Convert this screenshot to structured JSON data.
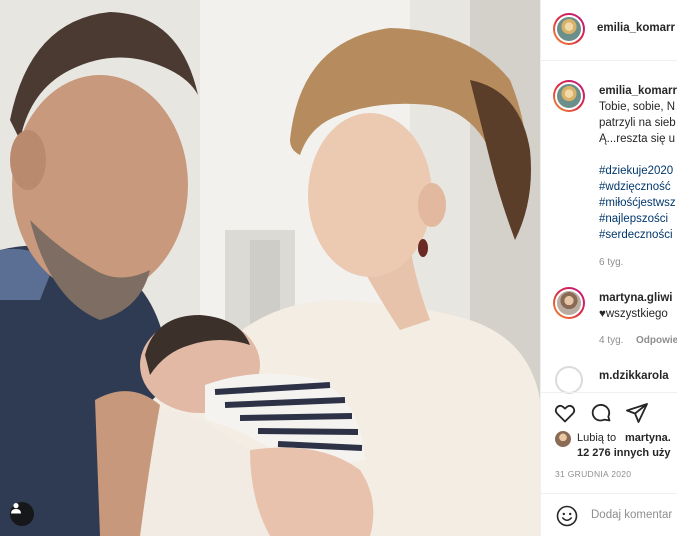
{
  "post": {
    "username": "emilia_komarr",
    "avatar_icon": "profile-avatar",
    "caption_username": "emilia_komarr",
    "caption_lines": [
      "Tobie, sobie, N",
      "patrzyli na sieb",
      "Ą...reszta się u"
    ],
    "hashtags": [
      "#dziekuje2020",
      "#wdzięczność",
      "#miłośćjestwsz",
      "#najlepszości",
      "#serdeczności"
    ],
    "caption_time": "6 tyg.",
    "comments": [
      {
        "username": "martyna.gliwi",
        "text": "♥wszystkiego",
        "time": "4 tyg.",
        "reply_label": "Odpowie"
      },
      {
        "username": "m.dzikkarola"
      }
    ],
    "likes": {
      "prefix": "Lubią to",
      "user": "martyna.",
      "others_line": "12 276 innych uży"
    },
    "date": "31 GRUDNIA 2020",
    "comment_placeholder": "Dodaj komentar"
  },
  "icons": {
    "like": "heart-icon",
    "comment": "comment-icon",
    "share": "paper-plane-icon",
    "emoji": "emoji-icon",
    "tag": "user-tag-icon"
  },
  "colors": {
    "hashtag": "#00376b",
    "muted": "#8e8e8e",
    "text": "#262626",
    "story_ring": "#dc2743"
  }
}
